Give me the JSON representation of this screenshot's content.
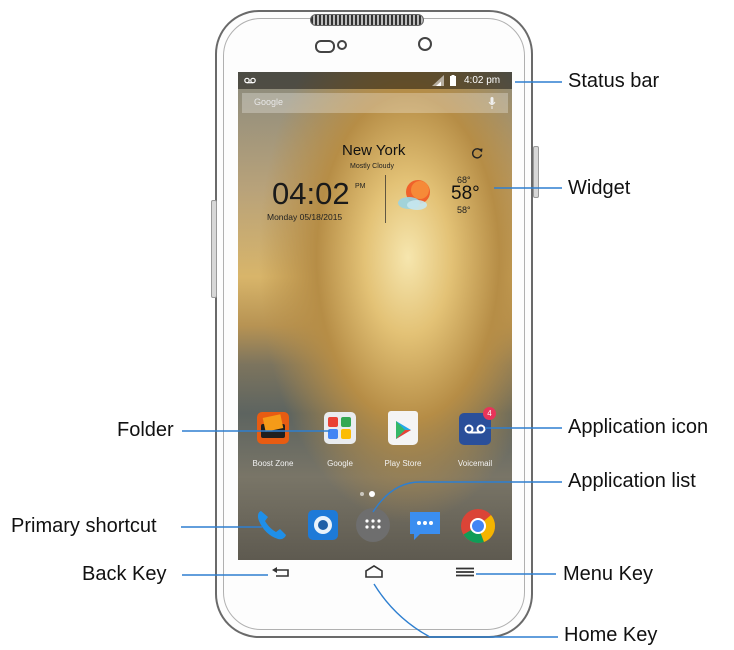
{
  "status_bar": {
    "voicemail_icon": "voicemail-icon",
    "signal_icon": "signal-icon",
    "battery_icon": "battery-icon",
    "time": "4:02 pm"
  },
  "search_bar": {
    "label": "Google",
    "mic_icon": "mic-icon"
  },
  "widget": {
    "city": "New York",
    "condition": "Mostly Cloudy",
    "clock_time": "04:02",
    "clock_ampm": "PM",
    "clock_date": "Monday  05/18/2015",
    "temp_high": "68°",
    "temp_current": "58°",
    "temp_low": "58°",
    "refresh_icon": "refresh-icon",
    "weather_icon": "partly-cloudy-icon"
  },
  "apps": [
    {
      "label": "Boost Zone",
      "icon": "boost-zone-folder-icon"
    },
    {
      "label": "Google",
      "icon": "google-folder-icon"
    },
    {
      "label": "Play Store",
      "icon": "play-store-icon"
    },
    {
      "label": "Voicemail",
      "icon": "voicemail-app-icon",
      "badge": "4"
    }
  ],
  "dock": [
    {
      "icon": "phone-icon"
    },
    {
      "icon": "camera-icon"
    },
    {
      "icon": "app-list-icon"
    },
    {
      "icon": "messaging-icon"
    },
    {
      "icon": "chrome-icon"
    }
  ],
  "keys": {
    "back_icon": "back-key-icon",
    "home_icon": "home-key-icon",
    "menu_icon": "menu-key-icon"
  },
  "callouts": {
    "status_bar": "Status bar",
    "widget": "Widget",
    "folder": "Folder",
    "application_icon": "Application icon",
    "application_list": "Application list",
    "primary_shortcut": "Primary shortcut",
    "back_key": "Back Key",
    "menu_key": "Menu Key",
    "home_key": "Home Key"
  },
  "colors": {
    "phone_orange": "#2f8be8",
    "badge": "#e8345a",
    "leader_line": "#2e7fd0"
  }
}
